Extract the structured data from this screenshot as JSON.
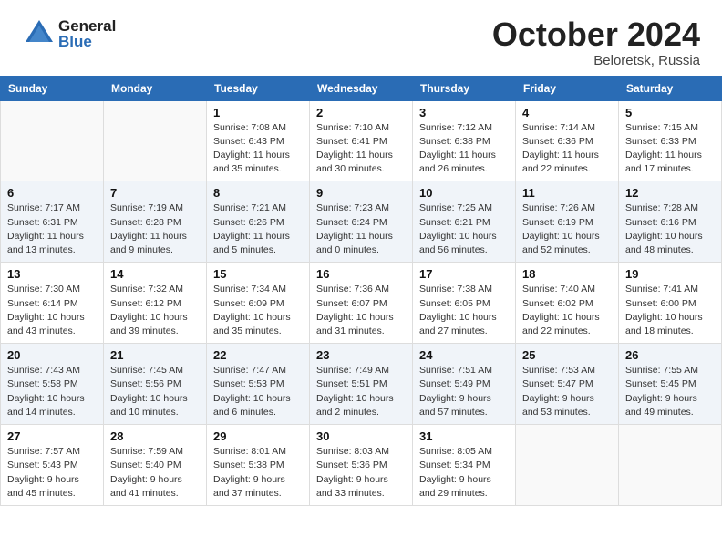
{
  "header": {
    "logo_general": "General",
    "logo_blue": "Blue",
    "month": "October 2024",
    "location": "Beloretsk, Russia"
  },
  "days_of_week": [
    "Sunday",
    "Monday",
    "Tuesday",
    "Wednesday",
    "Thursday",
    "Friday",
    "Saturday"
  ],
  "weeks": [
    [
      {
        "day": "",
        "content": ""
      },
      {
        "day": "",
        "content": ""
      },
      {
        "day": "1",
        "content": "Sunrise: 7:08 AM\nSunset: 6:43 PM\nDaylight: 11 hours and 35 minutes."
      },
      {
        "day": "2",
        "content": "Sunrise: 7:10 AM\nSunset: 6:41 PM\nDaylight: 11 hours and 30 minutes."
      },
      {
        "day": "3",
        "content": "Sunrise: 7:12 AM\nSunset: 6:38 PM\nDaylight: 11 hours and 26 minutes."
      },
      {
        "day": "4",
        "content": "Sunrise: 7:14 AM\nSunset: 6:36 PM\nDaylight: 11 hours and 22 minutes."
      },
      {
        "day": "5",
        "content": "Sunrise: 7:15 AM\nSunset: 6:33 PM\nDaylight: 11 hours and 17 minutes."
      }
    ],
    [
      {
        "day": "6",
        "content": "Sunrise: 7:17 AM\nSunset: 6:31 PM\nDaylight: 11 hours and 13 minutes."
      },
      {
        "day": "7",
        "content": "Sunrise: 7:19 AM\nSunset: 6:28 PM\nDaylight: 11 hours and 9 minutes."
      },
      {
        "day": "8",
        "content": "Sunrise: 7:21 AM\nSunset: 6:26 PM\nDaylight: 11 hours and 5 minutes."
      },
      {
        "day": "9",
        "content": "Sunrise: 7:23 AM\nSunset: 6:24 PM\nDaylight: 11 hours and 0 minutes."
      },
      {
        "day": "10",
        "content": "Sunrise: 7:25 AM\nSunset: 6:21 PM\nDaylight: 10 hours and 56 minutes."
      },
      {
        "day": "11",
        "content": "Sunrise: 7:26 AM\nSunset: 6:19 PM\nDaylight: 10 hours and 52 minutes."
      },
      {
        "day": "12",
        "content": "Sunrise: 7:28 AM\nSunset: 6:16 PM\nDaylight: 10 hours and 48 minutes."
      }
    ],
    [
      {
        "day": "13",
        "content": "Sunrise: 7:30 AM\nSunset: 6:14 PM\nDaylight: 10 hours and 43 minutes."
      },
      {
        "day": "14",
        "content": "Sunrise: 7:32 AM\nSunset: 6:12 PM\nDaylight: 10 hours and 39 minutes."
      },
      {
        "day": "15",
        "content": "Sunrise: 7:34 AM\nSunset: 6:09 PM\nDaylight: 10 hours and 35 minutes."
      },
      {
        "day": "16",
        "content": "Sunrise: 7:36 AM\nSunset: 6:07 PM\nDaylight: 10 hours and 31 minutes."
      },
      {
        "day": "17",
        "content": "Sunrise: 7:38 AM\nSunset: 6:05 PM\nDaylight: 10 hours and 27 minutes."
      },
      {
        "day": "18",
        "content": "Sunrise: 7:40 AM\nSunset: 6:02 PM\nDaylight: 10 hours and 22 minutes."
      },
      {
        "day": "19",
        "content": "Sunrise: 7:41 AM\nSunset: 6:00 PM\nDaylight: 10 hours and 18 minutes."
      }
    ],
    [
      {
        "day": "20",
        "content": "Sunrise: 7:43 AM\nSunset: 5:58 PM\nDaylight: 10 hours and 14 minutes."
      },
      {
        "day": "21",
        "content": "Sunrise: 7:45 AM\nSunset: 5:56 PM\nDaylight: 10 hours and 10 minutes."
      },
      {
        "day": "22",
        "content": "Sunrise: 7:47 AM\nSunset: 5:53 PM\nDaylight: 10 hours and 6 minutes."
      },
      {
        "day": "23",
        "content": "Sunrise: 7:49 AM\nSunset: 5:51 PM\nDaylight: 10 hours and 2 minutes."
      },
      {
        "day": "24",
        "content": "Sunrise: 7:51 AM\nSunset: 5:49 PM\nDaylight: 9 hours and 57 minutes."
      },
      {
        "day": "25",
        "content": "Sunrise: 7:53 AM\nSunset: 5:47 PM\nDaylight: 9 hours and 53 minutes."
      },
      {
        "day": "26",
        "content": "Sunrise: 7:55 AM\nSunset: 5:45 PM\nDaylight: 9 hours and 49 minutes."
      }
    ],
    [
      {
        "day": "27",
        "content": "Sunrise: 7:57 AM\nSunset: 5:43 PM\nDaylight: 9 hours and 45 minutes."
      },
      {
        "day": "28",
        "content": "Sunrise: 7:59 AM\nSunset: 5:40 PM\nDaylight: 9 hours and 41 minutes."
      },
      {
        "day": "29",
        "content": "Sunrise: 8:01 AM\nSunset: 5:38 PM\nDaylight: 9 hours and 37 minutes."
      },
      {
        "day": "30",
        "content": "Sunrise: 8:03 AM\nSunset: 5:36 PM\nDaylight: 9 hours and 33 minutes."
      },
      {
        "day": "31",
        "content": "Sunrise: 8:05 AM\nSunset: 5:34 PM\nDaylight: 9 hours and 29 minutes."
      },
      {
        "day": "",
        "content": ""
      },
      {
        "day": "",
        "content": ""
      }
    ]
  ]
}
